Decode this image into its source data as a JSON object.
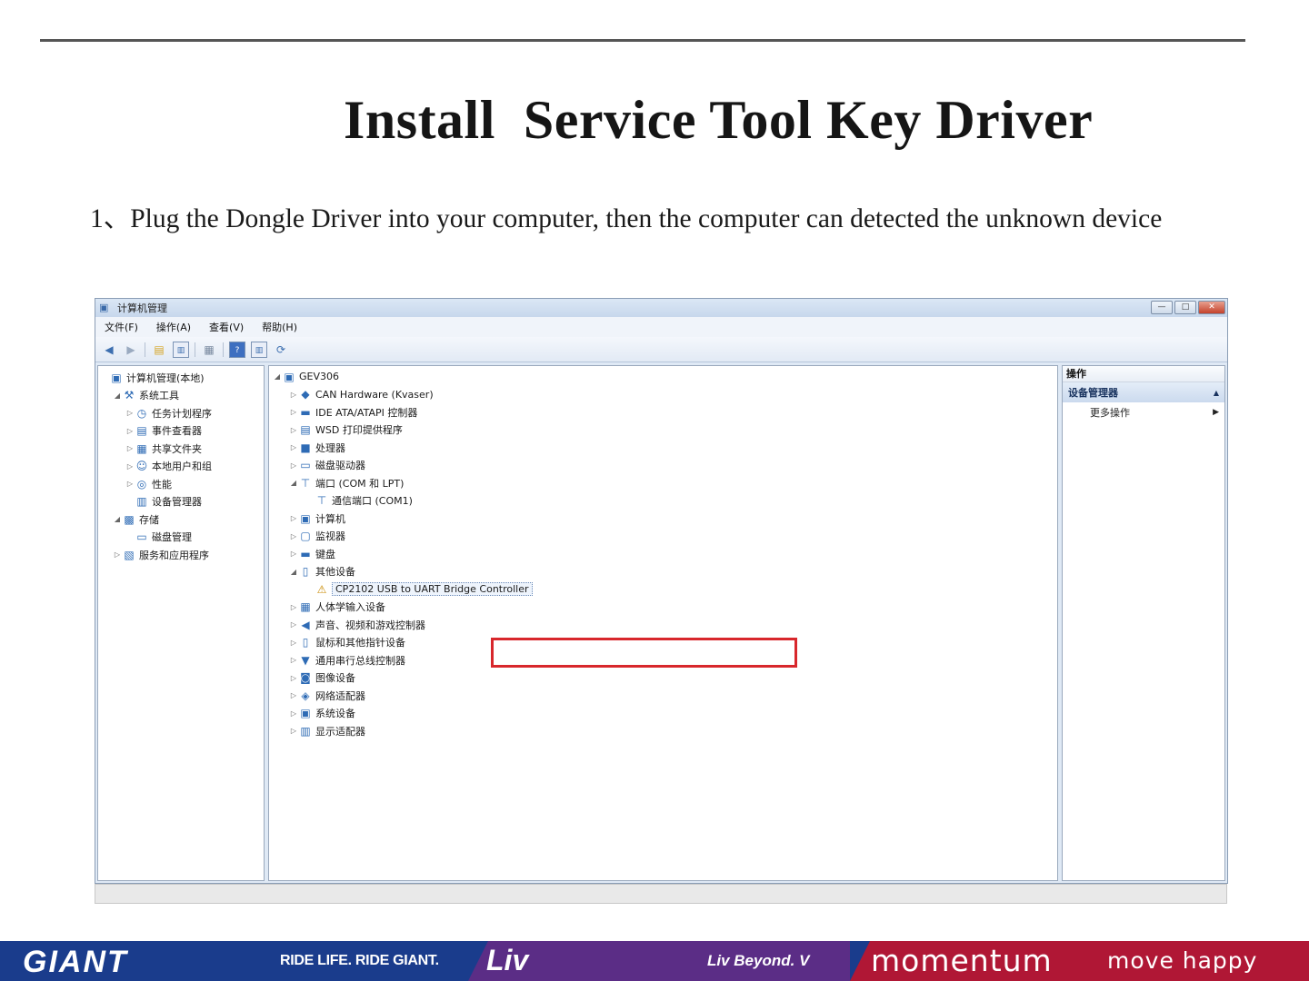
{
  "slide": {
    "title": "Install  Service Tool Key Driver",
    "step_text": "1、Plug the Dongle Driver into your computer, then the computer can  detected  the unknown device"
  },
  "window": {
    "title": "计算机管理",
    "controls": {
      "minimize": "—",
      "maximize": "□",
      "close": "✕"
    },
    "menu": [
      "文件(F)",
      "操作(A)",
      "查看(V)",
      "帮助(H)"
    ],
    "toolbar_icons": [
      "back-arrow-icon",
      "forward-arrow-icon",
      "up-folder-icon",
      "console-tree-icon",
      "export-list-icon",
      "help-icon",
      "properties-icon",
      "refresh-icon"
    ],
    "left_tree": [
      {
        "label": "计算机管理(本地)",
        "level": 0,
        "icon": "computer-management-icon",
        "toggle": ""
      },
      {
        "label": "系统工具",
        "level": 1,
        "icon": "tools-icon",
        "toggle": "◢"
      },
      {
        "label": "任务计划程序",
        "level": 2,
        "icon": "clock-icon",
        "toggle": "▷"
      },
      {
        "label": "事件查看器",
        "level": 2,
        "icon": "event-viewer-icon",
        "toggle": "▷"
      },
      {
        "label": "共享文件夹",
        "level": 2,
        "icon": "shared-folder-icon",
        "toggle": "▷"
      },
      {
        "label": "本地用户和组",
        "level": 2,
        "icon": "users-icon",
        "toggle": "▷"
      },
      {
        "label": "性能",
        "level": 2,
        "icon": "performance-icon",
        "toggle": "▷"
      },
      {
        "label": "设备管理器",
        "level": 2,
        "icon": "device-manager-icon",
        "toggle": ""
      },
      {
        "label": "存储",
        "level": 1,
        "icon": "storage-icon",
        "toggle": "◢"
      },
      {
        "label": "磁盘管理",
        "level": 2,
        "icon": "disk-management-icon",
        "toggle": ""
      },
      {
        "label": "服务和应用程序",
        "level": 1,
        "icon": "services-icon",
        "toggle": "▷"
      }
    ],
    "device_tree": [
      {
        "label": "GEV306",
        "level": 0,
        "icon": "computer-icon",
        "toggle": "◢"
      },
      {
        "label": "CAN Hardware (Kvaser)",
        "level": 1,
        "icon": "can-hardware-icon",
        "toggle": "▷"
      },
      {
        "label": "IDE ATA/ATAPI 控制器",
        "level": 1,
        "icon": "ide-controller-icon",
        "toggle": "▷"
      },
      {
        "label": "WSD 打印提供程序",
        "level": 1,
        "icon": "printer-icon",
        "toggle": "▷"
      },
      {
        "label": "处理器",
        "level": 1,
        "icon": "processor-icon",
        "toggle": "▷"
      },
      {
        "label": "磁盘驱动器",
        "level": 1,
        "icon": "disk-drive-icon",
        "toggle": "▷"
      },
      {
        "label": "端口 (COM 和 LPT)",
        "level": 1,
        "icon": "port-icon",
        "toggle": "◢"
      },
      {
        "label": "通信端口 (COM1)",
        "level": 2,
        "icon": "port-icon",
        "toggle": ""
      },
      {
        "label": "计算机",
        "level": 1,
        "icon": "computer-icon",
        "toggle": "▷"
      },
      {
        "label": "监视器",
        "level": 1,
        "icon": "monitor-icon",
        "toggle": "▷"
      },
      {
        "label": "键盘",
        "level": 1,
        "icon": "keyboard-icon",
        "toggle": "▷"
      },
      {
        "label": "其他设备",
        "level": 1,
        "icon": "other-devices-icon",
        "toggle": "◢"
      },
      {
        "label": "CP2102 USB to UART Bridge Controller",
        "level": 2,
        "icon": "warning-icon",
        "toggle": "",
        "highlighted": true
      },
      {
        "label": "人体学输入设备",
        "level": 1,
        "icon": "hid-icon",
        "toggle": "▷"
      },
      {
        "label": "声音、视频和游戏控制器",
        "level": 1,
        "icon": "sound-icon",
        "toggle": "▷"
      },
      {
        "label": "鼠标和其他指针设备",
        "level": 1,
        "icon": "mouse-icon",
        "toggle": "▷"
      },
      {
        "label": "通用串行总线控制器",
        "level": 1,
        "icon": "usb-icon",
        "toggle": "▷"
      },
      {
        "label": "图像设备",
        "level": 1,
        "icon": "camera-icon",
        "toggle": "▷"
      },
      {
        "label": "网络适配器",
        "level": 1,
        "icon": "network-icon",
        "toggle": "▷"
      },
      {
        "label": "系统设备",
        "level": 1,
        "icon": "system-device-icon",
        "toggle": "▷"
      },
      {
        "label": "显示适配器",
        "level": 1,
        "icon": "display-adapter-icon",
        "toggle": "▷"
      }
    ],
    "actions": {
      "header": "操作",
      "group": "设备管理器",
      "group_arrow": "▲",
      "more": "更多操作",
      "more_arrow": "▶"
    }
  },
  "footer": {
    "giant_logo": "GIANT",
    "giant_tagline": "RIDE LIFE. RIDE GIANT.",
    "liv_logo": "Liv",
    "liv_tagline": "Liv Beyond. V",
    "momentum_logo": "momentum",
    "momentum_tagline": "move happy",
    "colors": {
      "giant": "#1a3c8c",
      "liv": "#5b2d86",
      "momentum": "#b01735",
      "highlight": "#d8272c"
    }
  }
}
